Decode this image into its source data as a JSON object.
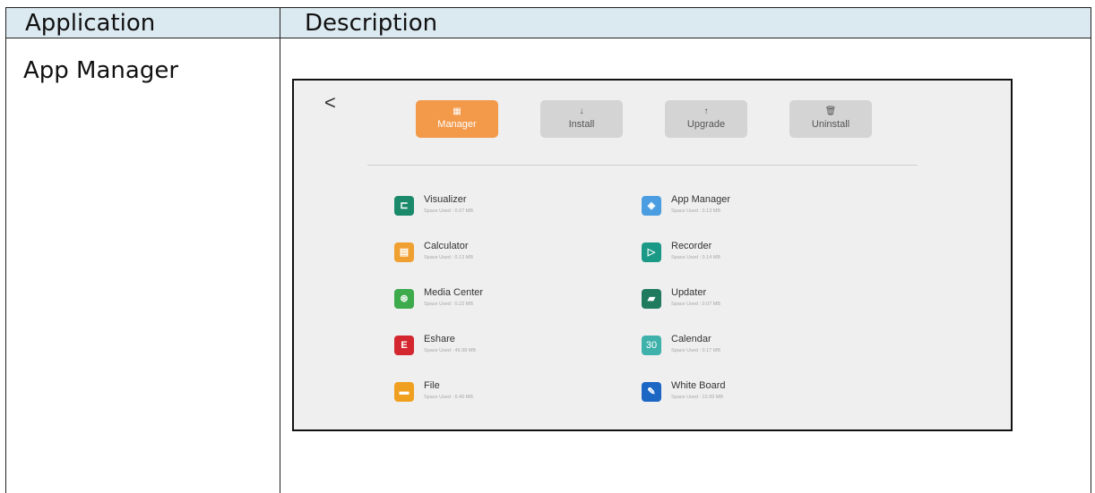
{
  "table": {
    "headers": [
      "Application",
      "Description"
    ],
    "row_label": "App Manager"
  },
  "screen": {
    "back_glyph": "<",
    "tabs": [
      {
        "label": "Manager",
        "icon": "grid-icon"
      },
      {
        "label": "Install",
        "icon": "arrow-down-icon"
      },
      {
        "label": "Upgrade",
        "icon": "arrow-up-icon"
      },
      {
        "label": "Uninstall",
        "icon": "trash-icon"
      }
    ],
    "apps": [
      {
        "name": "Visualizer",
        "used": "Space Used : 0.07 MB",
        "color": "#1b8a6b"
      },
      {
        "name": "App Manager",
        "used": "Space Used : 0.13 MB",
        "color": "#4a9de0"
      },
      {
        "name": "Calculator",
        "used": "Space Used : 0.13 MB",
        "color": "#f0a030"
      },
      {
        "name": "Recorder",
        "used": "Space Used : 0.14 MB",
        "color": "#1a9a86"
      },
      {
        "name": "Media Center",
        "used": "Space Used : 0.22 MB",
        "color": "#3daa4c"
      },
      {
        "name": "Updater",
        "used": "Space Used : 0.07 MB",
        "color": "#1f7a5e"
      },
      {
        "name": "Eshare",
        "used": "Space Used : 46.98 MB",
        "color": "#d4262e"
      },
      {
        "name": "Calendar",
        "used": "Space Used : 0.17 MB",
        "color": "#3fb1ab"
      },
      {
        "name": "File",
        "used": "Space Used : 6.40 MB",
        "color": "#f0a020"
      },
      {
        "name": "White Board",
        "used": "Space Used : 10.99 MB",
        "color": "#1c66c4"
      }
    ]
  }
}
